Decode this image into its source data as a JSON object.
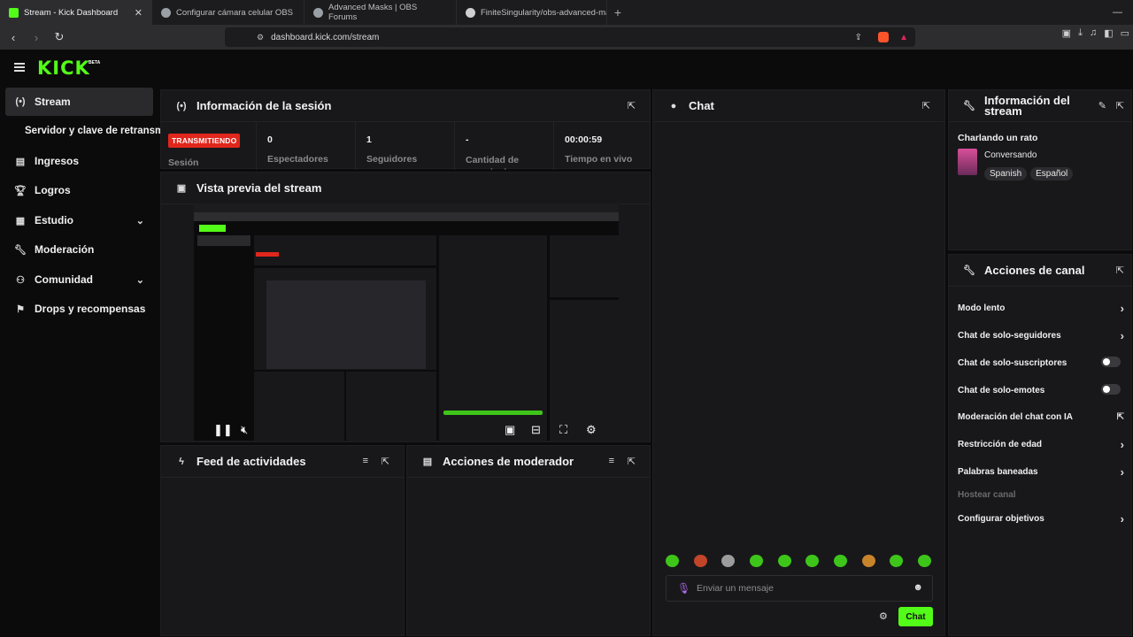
{
  "browser": {
    "tabs": [
      {
        "title": "Stream - Kick Dashboard",
        "favicon_color": "#53fc18"
      },
      {
        "title": "Configurar cámara celular OBS",
        "favicon_color": "#9aa0a6"
      },
      {
        "title": "Advanced Masks | OBS Forums",
        "favicon_color": "#9aa0a6"
      },
      {
        "title": "FiniteSingularity/obs-advanced-mask",
        "favicon_color": "#cfcfcf"
      }
    ],
    "url": "dashboard.kick.com/stream"
  },
  "header": {
    "logo": "KICK",
    "logo_badge": "BETA"
  },
  "sidebar": {
    "items": [
      {
        "label": "Stream",
        "icon": "broadcast-icon"
      },
      {
        "label": "Servidor y clave de retransm",
        "icon": ""
      },
      {
        "label": "Ingresos",
        "icon": "chart-icon"
      },
      {
        "label": "Logros",
        "icon": "trophy-icon"
      },
      {
        "label": "Estudio",
        "icon": "studio-icon"
      },
      {
        "label": "Moderación",
        "icon": "wrench-icon"
      },
      {
        "label": "Comunidad",
        "icon": "community-icon"
      },
      {
        "label": "Drops y recompensas",
        "icon": "drops-icon"
      }
    ]
  },
  "session": {
    "title": "Información de la sesión",
    "live_badge": "TRANSMITIENDO",
    "status_label": "Sesión",
    "stats": [
      {
        "value": "0",
        "label": "Espectadores"
      },
      {
        "value": "1",
        "label": "Seguidores"
      },
      {
        "value": "-",
        "label": "Cantidad de suscripciones"
      },
      {
        "value": "00:00:59",
        "label": "Tiempo en vivo"
      }
    ]
  },
  "preview": {
    "title": "Vista previa del stream"
  },
  "feed": {
    "title": "Feed de actividades"
  },
  "modactions": {
    "title": "Acciones de moderador"
  },
  "chat": {
    "title": "Chat",
    "placeholder": "Enviar un mensaje",
    "send_label": "Chat",
    "emote_count": 10
  },
  "stream_info": {
    "title": "Información del stream",
    "stream_title": "Charlando un rato",
    "category": "Conversando",
    "tags": [
      "Spanish",
      "Español"
    ]
  },
  "channel_actions": {
    "title": "Acciones de canal",
    "items": [
      {
        "label": "Modo lento",
        "control": "chevron"
      },
      {
        "label": "Chat de solo-seguidores",
        "control": "chevron"
      },
      {
        "label": "Chat de solo-suscriptores",
        "control": "toggle"
      },
      {
        "label": "Chat de solo-emotes",
        "control": "toggle"
      },
      {
        "label": "Moderación del chat con IA",
        "control": "external"
      },
      {
        "label": "Restricción de edad",
        "control": "chevron"
      },
      {
        "label": "Palabras baneadas",
        "control": "chevron"
      },
      {
        "label": "Hostear canal",
        "control": "none"
      },
      {
        "label": "Configurar objetivos",
        "control": "chevron"
      }
    ]
  },
  "colors": {
    "accent": "#53fc18",
    "live": "#e1261c",
    "panel": "#18181b",
    "background": "#0b0b0c"
  }
}
